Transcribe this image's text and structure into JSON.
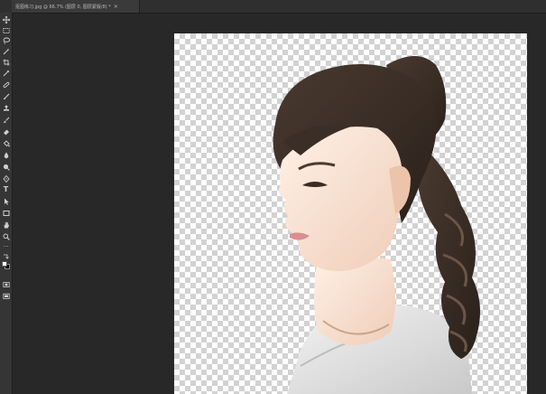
{
  "document": {
    "tab_title": "抠图练习.jpg @ 66.7% (图层 0, 图层蒙版/8) *",
    "close_glyph": "×"
  },
  "toolbar": {
    "tools": [
      {
        "name": "move-tool",
        "icon": "move-icon"
      },
      {
        "name": "marquee-tool",
        "icon": "marquee-icon"
      },
      {
        "name": "lasso-tool",
        "icon": "lasso-icon"
      },
      {
        "name": "quick-select-tool",
        "icon": "wand-icon"
      },
      {
        "name": "crop-tool",
        "icon": "crop-icon"
      },
      {
        "name": "eyedropper-tool",
        "icon": "eyedropper-icon"
      },
      {
        "name": "healing-tool",
        "icon": "bandage-icon"
      },
      {
        "name": "brush-tool",
        "icon": "brush-icon"
      },
      {
        "name": "clone-stamp-tool",
        "icon": "stamp-icon"
      },
      {
        "name": "history-brush-tool",
        "icon": "history-brush-icon"
      },
      {
        "name": "eraser-tool",
        "icon": "eraser-icon"
      },
      {
        "name": "paint-bucket-tool",
        "icon": "bucket-icon"
      },
      {
        "name": "blur-tool",
        "icon": "drop-icon"
      },
      {
        "name": "dodge-tool",
        "icon": "dodge-icon"
      },
      {
        "name": "pen-tool",
        "icon": "pen-icon"
      },
      {
        "name": "type-tool",
        "icon": "type-icon"
      },
      {
        "name": "path-select-tool",
        "icon": "arrow-icon"
      },
      {
        "name": "rectangle-tool",
        "icon": "rectangle-icon"
      },
      {
        "name": "hand-tool",
        "icon": "hand-icon"
      },
      {
        "name": "zoom-tool",
        "icon": "zoom-icon"
      },
      {
        "name": "more-tools",
        "icon": "more-icon"
      }
    ],
    "type_glyph": "T",
    "more_glyph": "···",
    "foreground_color": "#ffffff",
    "background_color": "#000000"
  },
  "colors": {
    "workspace": "#282828",
    "toolbar": "#353535",
    "tab_active": "#3a3a3a"
  }
}
